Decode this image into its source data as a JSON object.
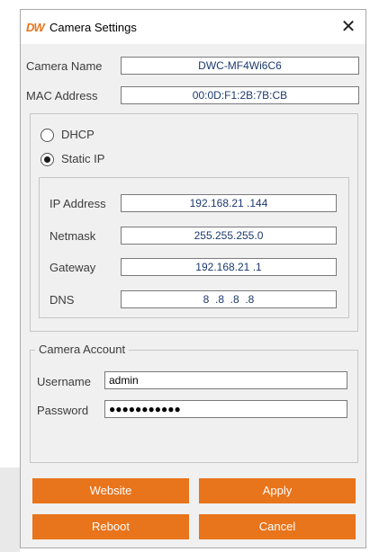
{
  "window": {
    "logo": "DW",
    "title": "Camera Settings",
    "close_glyph": "✕"
  },
  "camera": {
    "name_label": "Camera Name",
    "name_value": "DWC-MF4Wi6C6",
    "mac_label": "MAC Address",
    "mac_value": "00:0D:F1:2B:7B:CB"
  },
  "network": {
    "dhcp_label": "DHCP",
    "static_label": "Static IP",
    "selected": "Static IP",
    "ip_label": "IP Address",
    "ip_value": "192.168.21 .144",
    "netmask_label": "Netmask",
    "netmask_value": "255.255.255.0",
    "gateway_label": "Gateway",
    "gateway_value": "192.168.21 .1",
    "dns_label": "DNS",
    "dns_value": "8  .8  .8  .8"
  },
  "account": {
    "legend": "Camera Account",
    "username_label": "Username",
    "username_value": "admin",
    "password_label": "Password",
    "password_value": "●●●●●●●●●●●"
  },
  "buttons": {
    "website": "Website",
    "apply": "Apply",
    "reboot": "Reboot",
    "cancel": "Cancel"
  },
  "colors": {
    "accent": "#e8741b",
    "field_text": "#1c3a6e",
    "dialog_bg": "#f0f0f0"
  }
}
